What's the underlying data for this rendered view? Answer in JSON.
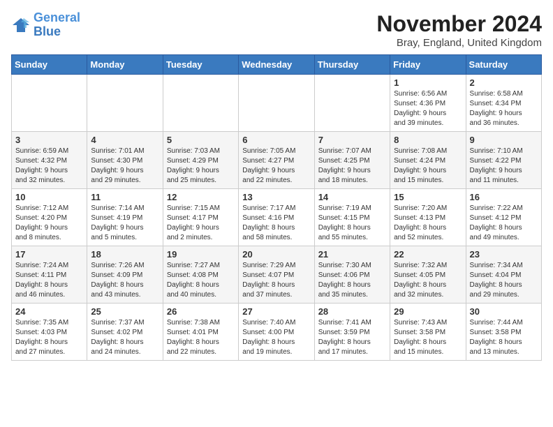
{
  "header": {
    "logo_line1": "General",
    "logo_line2": "Blue",
    "month_year": "November 2024",
    "location": "Bray, England, United Kingdom"
  },
  "days_of_week": [
    "Sunday",
    "Monday",
    "Tuesday",
    "Wednesday",
    "Thursday",
    "Friday",
    "Saturday"
  ],
  "weeks": [
    [
      {
        "day": "",
        "info": ""
      },
      {
        "day": "",
        "info": ""
      },
      {
        "day": "",
        "info": ""
      },
      {
        "day": "",
        "info": ""
      },
      {
        "day": "",
        "info": ""
      },
      {
        "day": "1",
        "info": "Sunrise: 6:56 AM\nSunset: 4:36 PM\nDaylight: 9 hours\nand 39 minutes."
      },
      {
        "day": "2",
        "info": "Sunrise: 6:58 AM\nSunset: 4:34 PM\nDaylight: 9 hours\nand 36 minutes."
      }
    ],
    [
      {
        "day": "3",
        "info": "Sunrise: 6:59 AM\nSunset: 4:32 PM\nDaylight: 9 hours\nand 32 minutes."
      },
      {
        "day": "4",
        "info": "Sunrise: 7:01 AM\nSunset: 4:30 PM\nDaylight: 9 hours\nand 29 minutes."
      },
      {
        "day": "5",
        "info": "Sunrise: 7:03 AM\nSunset: 4:29 PM\nDaylight: 9 hours\nand 25 minutes."
      },
      {
        "day": "6",
        "info": "Sunrise: 7:05 AM\nSunset: 4:27 PM\nDaylight: 9 hours\nand 22 minutes."
      },
      {
        "day": "7",
        "info": "Sunrise: 7:07 AM\nSunset: 4:25 PM\nDaylight: 9 hours\nand 18 minutes."
      },
      {
        "day": "8",
        "info": "Sunrise: 7:08 AM\nSunset: 4:24 PM\nDaylight: 9 hours\nand 15 minutes."
      },
      {
        "day": "9",
        "info": "Sunrise: 7:10 AM\nSunset: 4:22 PM\nDaylight: 9 hours\nand 11 minutes."
      }
    ],
    [
      {
        "day": "10",
        "info": "Sunrise: 7:12 AM\nSunset: 4:20 PM\nDaylight: 9 hours\nand 8 minutes."
      },
      {
        "day": "11",
        "info": "Sunrise: 7:14 AM\nSunset: 4:19 PM\nDaylight: 9 hours\nand 5 minutes."
      },
      {
        "day": "12",
        "info": "Sunrise: 7:15 AM\nSunset: 4:17 PM\nDaylight: 9 hours\nand 2 minutes."
      },
      {
        "day": "13",
        "info": "Sunrise: 7:17 AM\nSunset: 4:16 PM\nDaylight: 8 hours\nand 58 minutes."
      },
      {
        "day": "14",
        "info": "Sunrise: 7:19 AM\nSunset: 4:15 PM\nDaylight: 8 hours\nand 55 minutes."
      },
      {
        "day": "15",
        "info": "Sunrise: 7:20 AM\nSunset: 4:13 PM\nDaylight: 8 hours\nand 52 minutes."
      },
      {
        "day": "16",
        "info": "Sunrise: 7:22 AM\nSunset: 4:12 PM\nDaylight: 8 hours\nand 49 minutes."
      }
    ],
    [
      {
        "day": "17",
        "info": "Sunrise: 7:24 AM\nSunset: 4:11 PM\nDaylight: 8 hours\nand 46 minutes."
      },
      {
        "day": "18",
        "info": "Sunrise: 7:26 AM\nSunset: 4:09 PM\nDaylight: 8 hours\nand 43 minutes."
      },
      {
        "day": "19",
        "info": "Sunrise: 7:27 AM\nSunset: 4:08 PM\nDaylight: 8 hours\nand 40 minutes."
      },
      {
        "day": "20",
        "info": "Sunrise: 7:29 AM\nSunset: 4:07 PM\nDaylight: 8 hours\nand 37 minutes."
      },
      {
        "day": "21",
        "info": "Sunrise: 7:30 AM\nSunset: 4:06 PM\nDaylight: 8 hours\nand 35 minutes."
      },
      {
        "day": "22",
        "info": "Sunrise: 7:32 AM\nSunset: 4:05 PM\nDaylight: 8 hours\nand 32 minutes."
      },
      {
        "day": "23",
        "info": "Sunrise: 7:34 AM\nSunset: 4:04 PM\nDaylight: 8 hours\nand 29 minutes."
      }
    ],
    [
      {
        "day": "24",
        "info": "Sunrise: 7:35 AM\nSunset: 4:03 PM\nDaylight: 8 hours\nand 27 minutes."
      },
      {
        "day": "25",
        "info": "Sunrise: 7:37 AM\nSunset: 4:02 PM\nDaylight: 8 hours\nand 24 minutes."
      },
      {
        "day": "26",
        "info": "Sunrise: 7:38 AM\nSunset: 4:01 PM\nDaylight: 8 hours\nand 22 minutes."
      },
      {
        "day": "27",
        "info": "Sunrise: 7:40 AM\nSunset: 4:00 PM\nDaylight: 8 hours\nand 19 minutes."
      },
      {
        "day": "28",
        "info": "Sunrise: 7:41 AM\nSunset: 3:59 PM\nDaylight: 8 hours\nand 17 minutes."
      },
      {
        "day": "29",
        "info": "Sunrise: 7:43 AM\nSunset: 3:58 PM\nDaylight: 8 hours\nand 15 minutes."
      },
      {
        "day": "30",
        "info": "Sunrise: 7:44 AM\nSunset: 3:58 PM\nDaylight: 8 hours\nand 13 minutes."
      }
    ]
  ]
}
